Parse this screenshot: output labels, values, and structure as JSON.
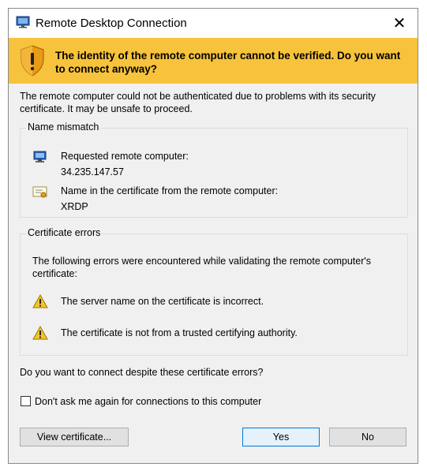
{
  "window": {
    "title": "Remote Desktop Connection",
    "close_glyph": "✕",
    "title_icon": "rdp-monitor-icon"
  },
  "banner": {
    "text": "The identity of the remote computer cannot be verified. Do you want to connect anyway?",
    "icon": "shield-warning-icon",
    "color": "#f7c33c"
  },
  "intro": "The remote computer could not be authenticated due to problems with its security certificate. It may be unsafe to proceed.",
  "name_mismatch": {
    "title": "Name mismatch",
    "requested_label": "Requested remote computer:",
    "requested_value": "34.235.147.57",
    "cert_name_label": "Name in the certificate from the remote computer:",
    "cert_name_value": "XRDP"
  },
  "certificate_errors": {
    "title": "Certificate errors",
    "description": "The following errors were encountered while validating the remote computer's certificate:",
    "errors": [
      "The server name on the certificate is incorrect.",
      "The certificate is not from a trusted certifying authority."
    ]
  },
  "question": "Do you want to connect despite these certificate errors?",
  "dont_ask": {
    "label": "Don't ask me again for connections to this computer",
    "checked": false
  },
  "buttons": {
    "view_certificate": "View certificate...",
    "yes": "Yes",
    "no": "No"
  },
  "colors": {
    "accent": "#0078d7",
    "warning": "#f7c33c"
  }
}
